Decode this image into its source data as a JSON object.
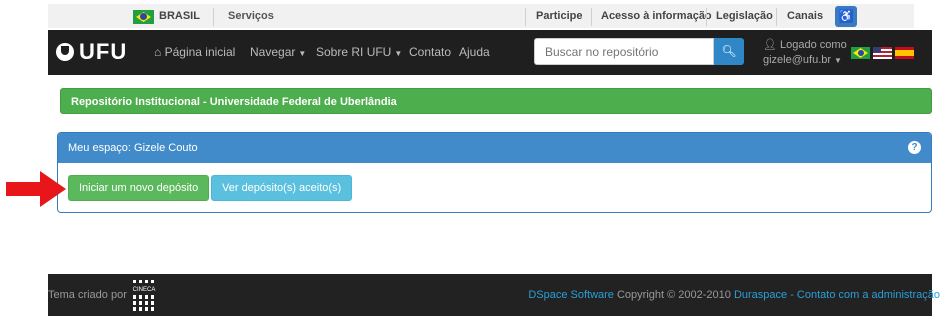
{
  "govbar": {
    "country": "BRASIL",
    "services": "Serviços",
    "links": [
      "Participe",
      "Acesso à informação",
      "Legislação",
      "Canais"
    ]
  },
  "navbar": {
    "logo": "UFU",
    "items": [
      "Página inicial",
      "Navegar",
      "Sobre RI UFU",
      "Contato",
      "Ajuda"
    ],
    "search_placeholder": "Buscar no repositório",
    "user_label": "Logado como",
    "user_email": "gizele@ufu.br"
  },
  "breadcrumb": {
    "title": "Repositório Institucional - Universidade Federal de Uberlândia"
  },
  "panel": {
    "title": "Meu espaço: Gizele Couto",
    "new_deposit_button": "Iniciar um novo depósito",
    "accepted_button": "Ver depósito(s) aceito(s)"
  },
  "footer": {
    "theme_label": "Tema criado por",
    "cineca_logo_text": "CINECA",
    "dspace_link": "DSpace Software",
    "copyright": " Copyright © 2002-2010 ",
    "duraspace_link": "Duraspace",
    "separator": " - ",
    "contact_link": "Contato com a administração"
  },
  "colors": {
    "navbar_bg": "#1f1f1f",
    "green_bar": "#4cae4c",
    "panel_heading": "#428bca",
    "btn_green": "#5cb85c",
    "btn_cyan": "#5bc0de",
    "arrow": "#e8161b",
    "footer_link": "#2a9fd6"
  }
}
